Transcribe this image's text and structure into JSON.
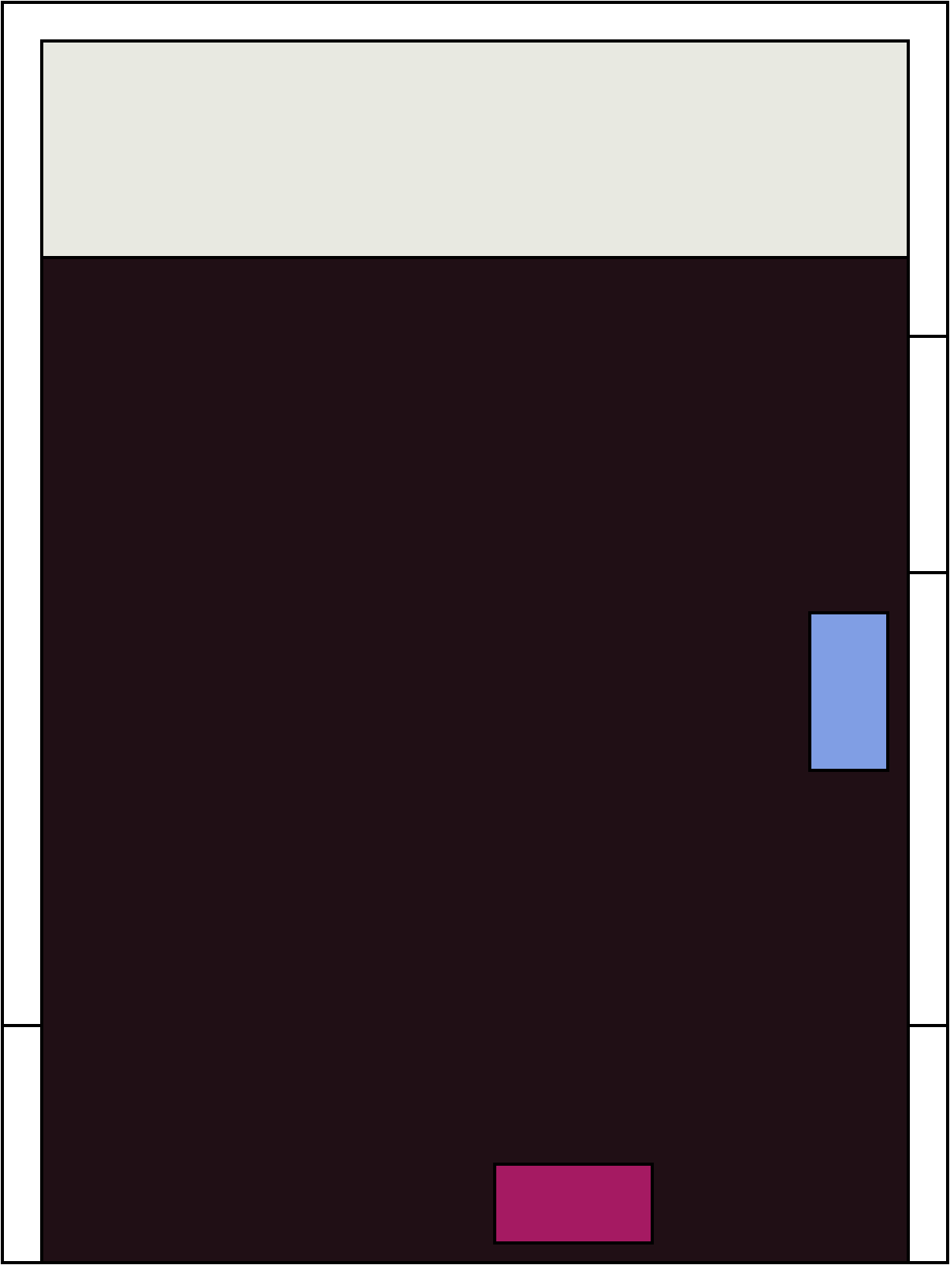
{
  "colors": {
    "background": "#ffffff",
    "outline": "#000000",
    "header_fill": "#e8e9e1",
    "body_fill": "#200f15",
    "blue_block": "#809ee4",
    "magenta_block": "#a51a62"
  },
  "regions": [
    {
      "name": "outer-frame",
      "fill": "background"
    },
    {
      "name": "header-panel",
      "fill": "header_fill"
    },
    {
      "name": "main-panel",
      "fill": "body_fill"
    },
    {
      "name": "blue-block",
      "fill": "blue_block"
    },
    {
      "name": "magenta-block",
      "fill": "magenta_block"
    }
  ]
}
